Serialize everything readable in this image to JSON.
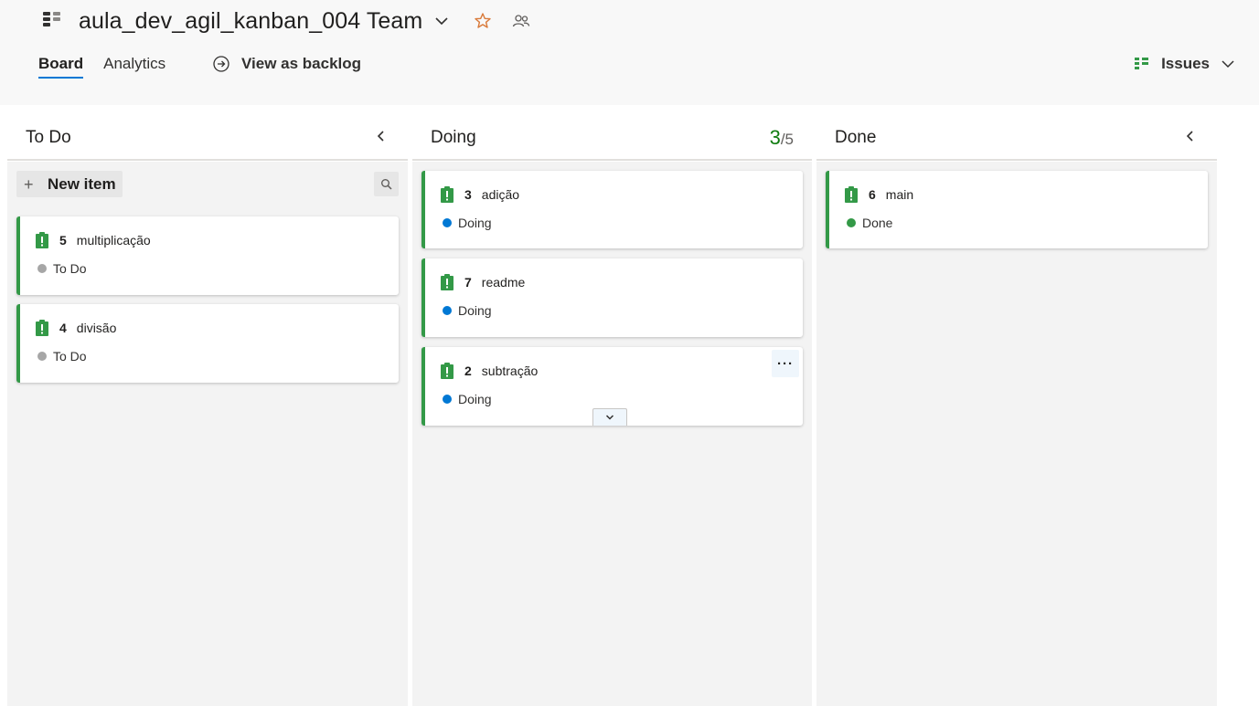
{
  "header": {
    "title": "aula_dev_agil_kanban_004 Team",
    "tabs": [
      {
        "label": "Board",
        "active": true
      },
      {
        "label": "Analytics",
        "active": false
      }
    ],
    "view_backlog_label": "View as backlog",
    "issues_label": "Issues"
  },
  "colors": {
    "accent": "#0078d4",
    "card_border": "#339947",
    "todo_dot": "#a6a6a6",
    "doing_dot": "#0078d4",
    "done_dot": "#339947",
    "wip_current": "#107c10"
  },
  "columns": [
    {
      "name": "To Do",
      "new_item_label": "New item",
      "cards": [
        {
          "id": "5",
          "title": "multiplicação",
          "state": "To Do"
        },
        {
          "id": "4",
          "title": "divisão",
          "state": "To Do"
        }
      ]
    },
    {
      "name": "Doing",
      "wip_current": "3",
      "wip_limit": "/5",
      "cards": [
        {
          "id": "3",
          "title": "adição",
          "state": "Doing"
        },
        {
          "id": "7",
          "title": "readme",
          "state": "Doing"
        },
        {
          "id": "2",
          "title": "subtração",
          "state": "Doing"
        }
      ]
    },
    {
      "name": "Done",
      "cards": [
        {
          "id": "6",
          "title": "main",
          "state": "Done"
        }
      ]
    }
  ],
  "icons": {
    "board": "board-icon",
    "favorite": "star-icon",
    "team": "team-members-icon",
    "backlog": "arrow-circle-icon",
    "issues": "backlog-list-icon",
    "card_type": "issue-clipboard-icon",
    "collapse": "chevron-left-icon",
    "search": "search-icon",
    "more": "more-icon",
    "expand": "chevron-down-icon"
  }
}
